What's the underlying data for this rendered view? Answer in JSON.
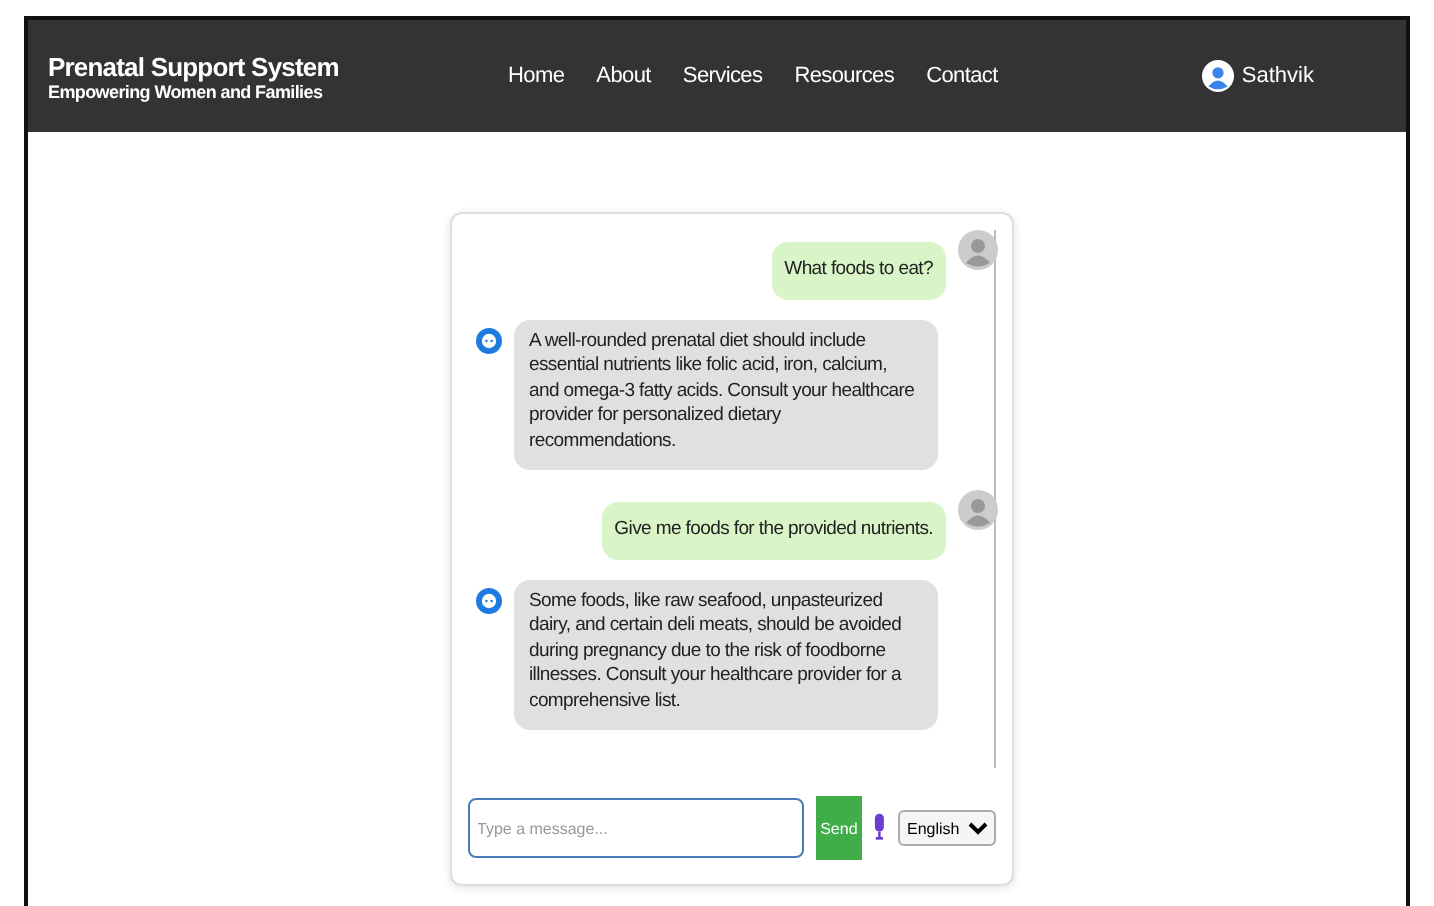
{
  "header": {
    "title": "Prenatal Support System",
    "subtitle": "Empowering Women and Families",
    "nav": [
      "Home",
      "About",
      "Services",
      "Resources",
      "Contact"
    ],
    "user": "Sathvik"
  },
  "messages": [
    {
      "kind": "user",
      "text": "What foods to eat?"
    },
    {
      "kind": "bot",
      "text": "A well-rounded prenatal diet should include essential nutrients like folic acid, iron, calcium, and omega-3 fatty acids. Consult your healthcare provider for personalized dietary recommendations."
    },
    {
      "kind": "user",
      "text": "Give me foods for the provided nutrients."
    },
    {
      "kind": "bot",
      "text": "Some foods, like raw seafood, unpasteurized dairy, and certain deli meats, should be avoided during pregnancy due to the risk of foodborne illnesses. Consult your healthcare provider for a comprehensive list."
    }
  ],
  "composer": {
    "placeholder": "Type a message...",
    "send": "Send",
    "language": "English"
  }
}
